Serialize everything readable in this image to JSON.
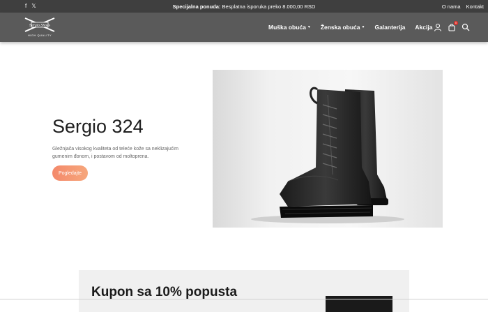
{
  "topbar": {
    "social": [
      "f",
      "𝕏"
    ],
    "promo_bold": "Specijalna ponuda:",
    "promo_text": " Besplatna isporuka preko 8.000,00 RSD",
    "links": [
      "O nama",
      "Kontakt"
    ]
  },
  "logo": {
    "brand": "Sergio Shoes",
    "tagline": "HIGH QUALITY"
  },
  "nav": {
    "menu": [
      {
        "label": "Muška obuća",
        "dropdown": true
      },
      {
        "label": "Ženska obuća",
        "dropdown": true
      },
      {
        "label": "Galanterija",
        "dropdown": false
      },
      {
        "label": "Akcija",
        "dropdown": false
      }
    ],
    "icons": [
      "user-icon",
      "cart-icon",
      "search-icon"
    ],
    "cart_count": "0"
  },
  "hero": {
    "title": "Sergio 324",
    "description": "Gležnjača visokog kvaliteta od telećе kože sa neklizajućim gumenim đonom, i postavom od moltoprena.",
    "cta": "Pogledajte"
  },
  "coupon": {
    "title": "Kupon sa 10% popusta"
  },
  "colors": {
    "topbar": "#3f3f3f",
    "navbar": "#5a5a5a",
    "accent": "#f4896b",
    "badge": "#e0322b"
  }
}
